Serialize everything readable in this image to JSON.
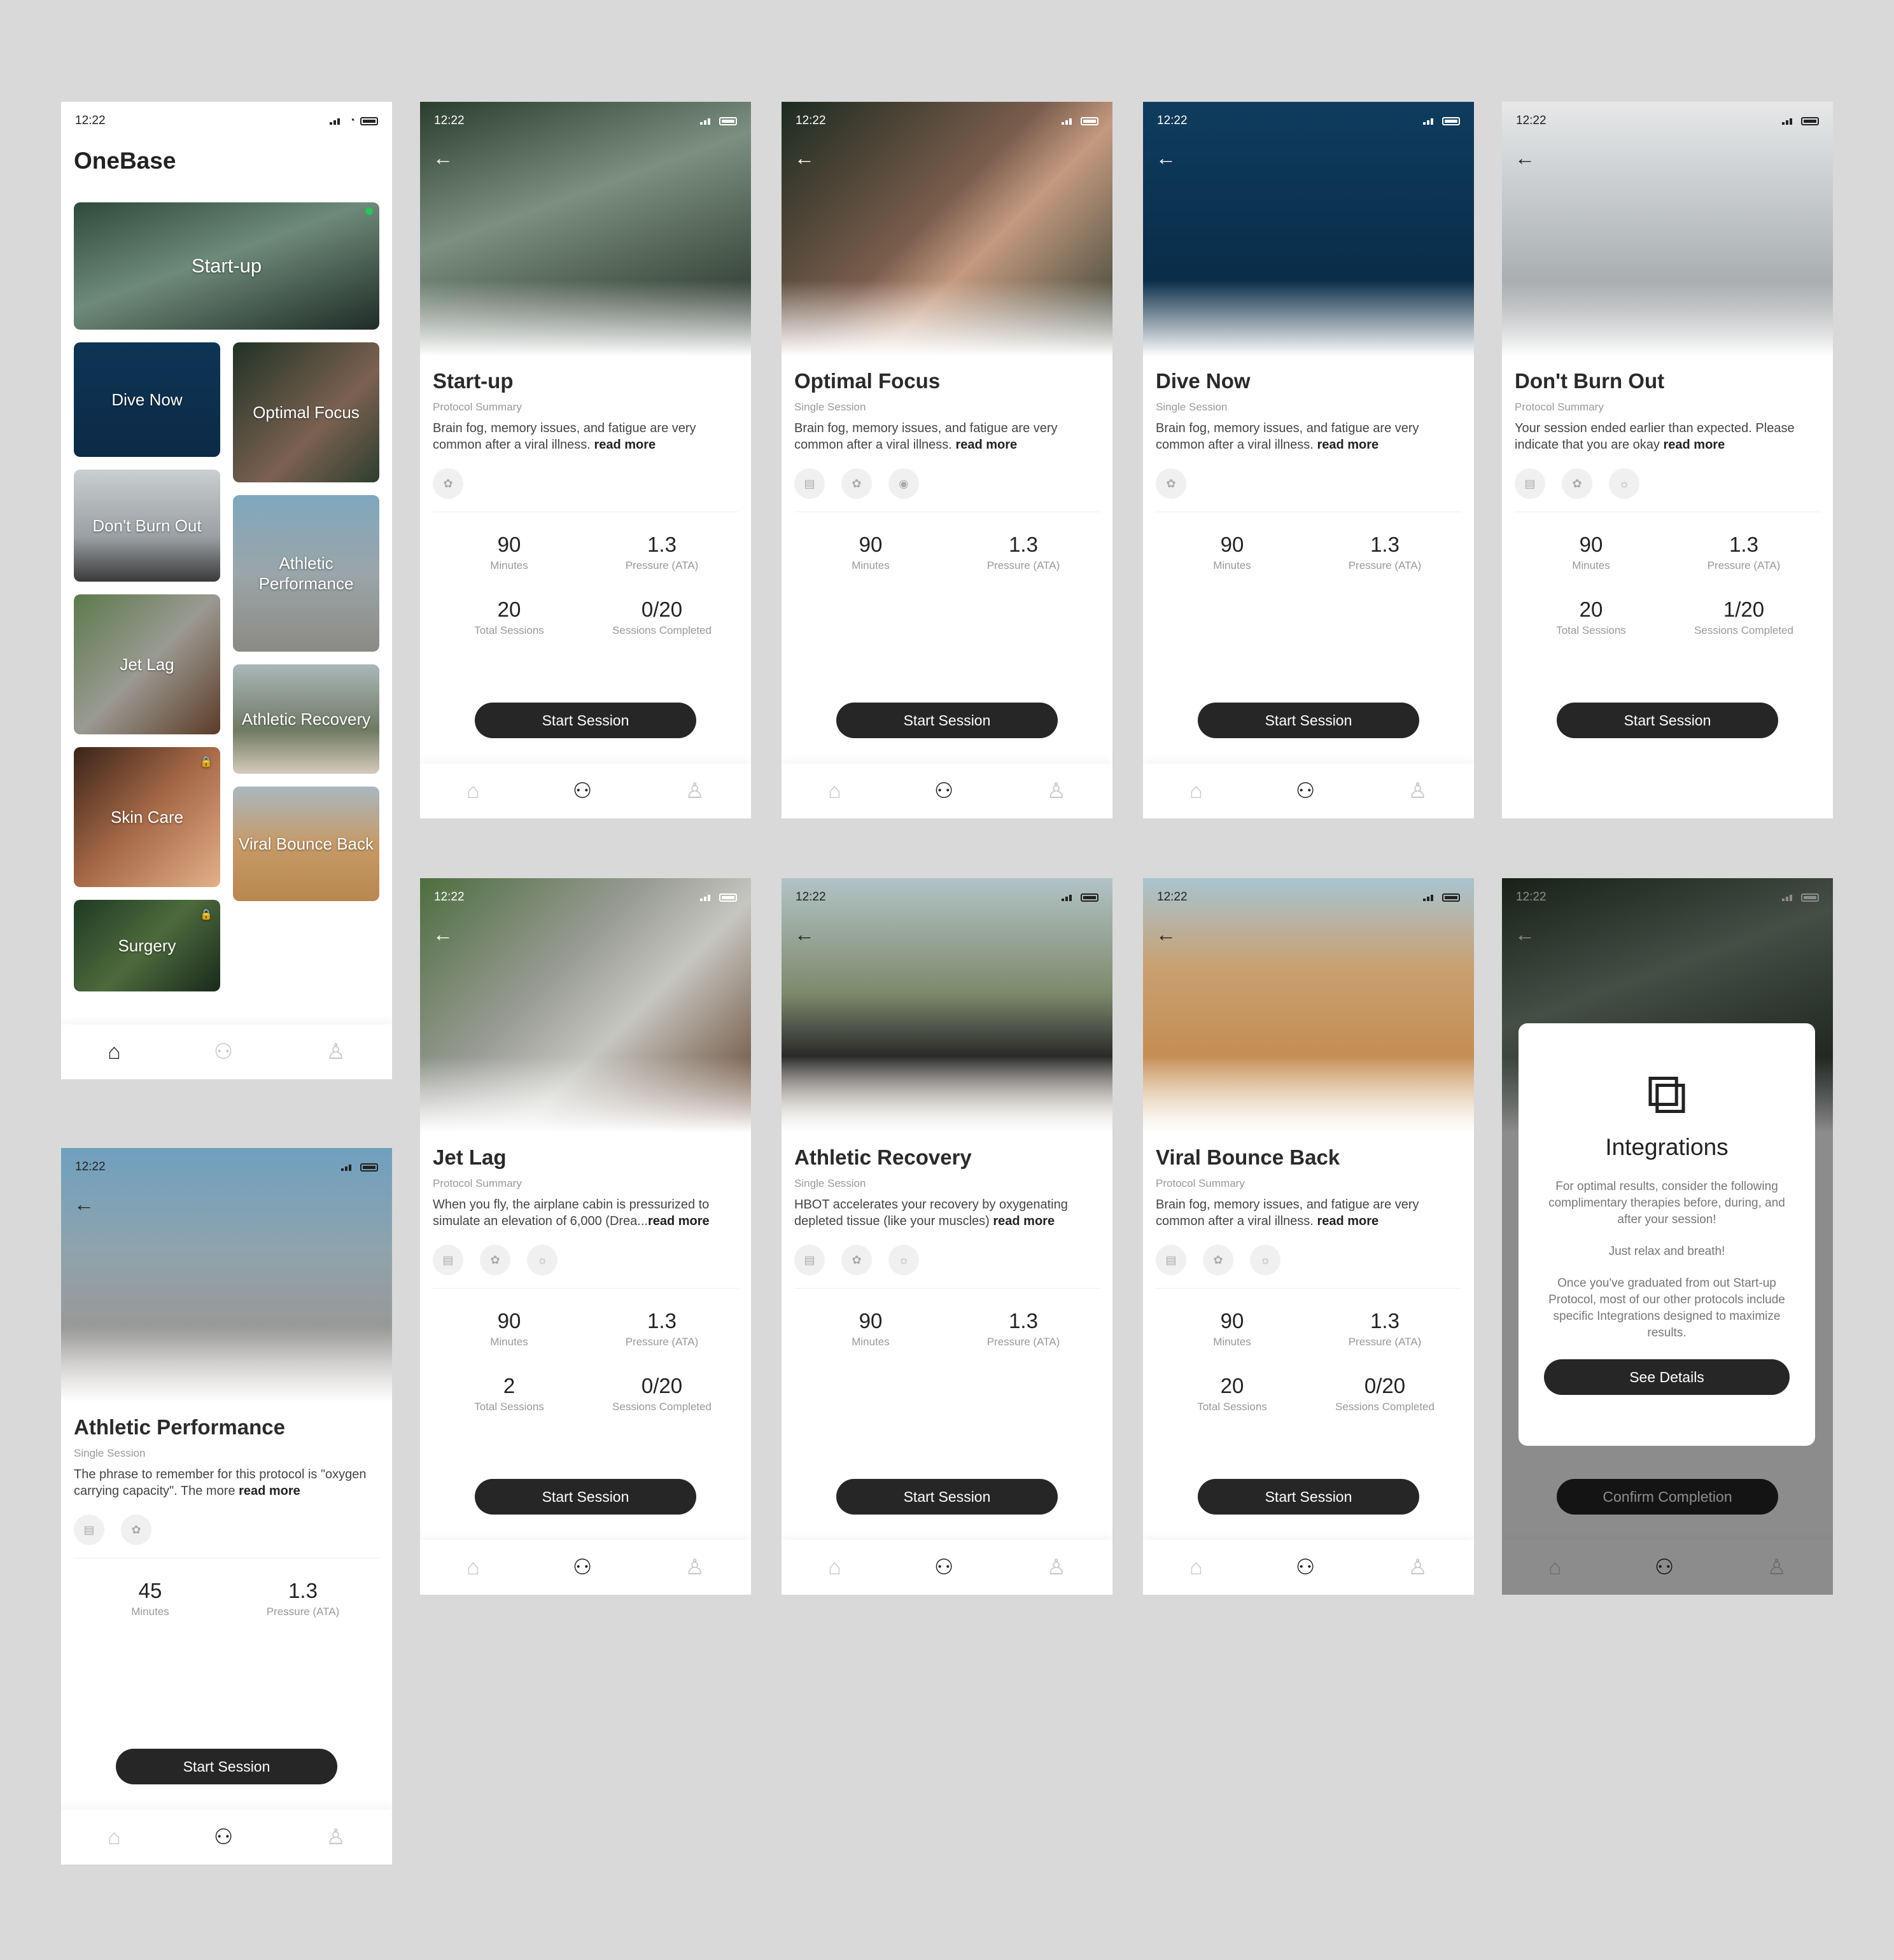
{
  "status": {
    "time": "12:22"
  },
  "home": {
    "app_title": "OneBase",
    "tiles": [
      "Start-up",
      "Dive Now",
      "Optimal Focus",
      "Don't Burn Out",
      "Athletic Performance",
      "Jet Lag",
      "Athletic Recovery",
      "Skin Care",
      "Viral Bounce Back",
      "Surgery"
    ]
  },
  "colors": {
    "button": "#262626",
    "active_dot": "#29c45a",
    "background": "#d9d9d9"
  },
  "icons": {
    "back": "arrow-left-icon",
    "home": "home-icon",
    "sessions": "sessions-icon",
    "profile": "profile-icon",
    "location": "location-arrow-icon"
  },
  "start_button": "Start Session",
  "labels": {
    "minutes": "Minutes",
    "pressure": "Pressure (ATA)",
    "total": "Total Sessions",
    "completed": "Sessions Completed"
  },
  "screens": {
    "startup": {
      "title": "Start-up",
      "type": "Protocol Summary",
      "desc": "Brain fog, memory issues, and fatigue are very common after a viral illness.",
      "more": "read more",
      "minutes": "90",
      "pressure": "1.3",
      "total": "20",
      "completed": "0/20"
    },
    "focus": {
      "title": "Optimal Focus",
      "type": "Single Session",
      "desc": "Brain fog, memory issues, and fatigue are very common after a viral illness.",
      "more": "read more",
      "minutes": "90",
      "pressure": "1.3"
    },
    "dive": {
      "title": "Dive Now",
      "type": "Single Session",
      "desc": "Brain fog, memory issues, and fatigue are very common after a viral illness.",
      "more": "read more",
      "minutes": "90",
      "pressure": "1.3"
    },
    "burnout": {
      "title": "Don't Burn Out",
      "type": "Protocol Summary",
      "desc": "Your session ended earlier than expected. Please indicate that you are okay",
      "more": "read more",
      "minutes": "90",
      "pressure": "1.3",
      "total": "20",
      "completed": "1/20"
    },
    "athletic_perf": {
      "title": "Athletic Performance",
      "type": "Single Session",
      "desc": "The phrase to remember for this protocol is \"oxygen carrying capacity\". The more",
      "more": "read more",
      "minutes": "45",
      "pressure": "1.3"
    },
    "jetlag": {
      "title": "Jet Lag",
      "type": "Protocol Summary",
      "desc": "When you fly, the airplane cabin is pressurized to simulate an elevation of 6,000 (Drea...",
      "more": "read more",
      "minutes": "90",
      "pressure": "1.3",
      "total": "2",
      "completed": "0/20"
    },
    "recovery": {
      "title": "Athletic Recovery",
      "type": "Single Session",
      "desc": "HBOT accelerates your recovery by oxygenating depleted tissue (like your muscles)",
      "more": "read more",
      "minutes": "90",
      "pressure": "1.3"
    },
    "viral": {
      "title": "Viral Bounce Back",
      "type": "Protocol Summary",
      "desc": "Brain fog, memory issues, and fatigue are very common after a viral illness.",
      "more": "read more",
      "minutes": "90",
      "pressure": "1.3",
      "total": "20",
      "completed": "0/20"
    }
  },
  "modal": {
    "title": "Integrations",
    "p1": "For optimal results, consider the following complimentary therapies before, during, and after your session!",
    "p2": "Just relax and breath!",
    "p3": "Once you've graduated from out Start-up Protocol, most of our other protocols include specific Integrations designed to maximize results.",
    "button": "See Details",
    "confirm": "Confirm Completion"
  }
}
